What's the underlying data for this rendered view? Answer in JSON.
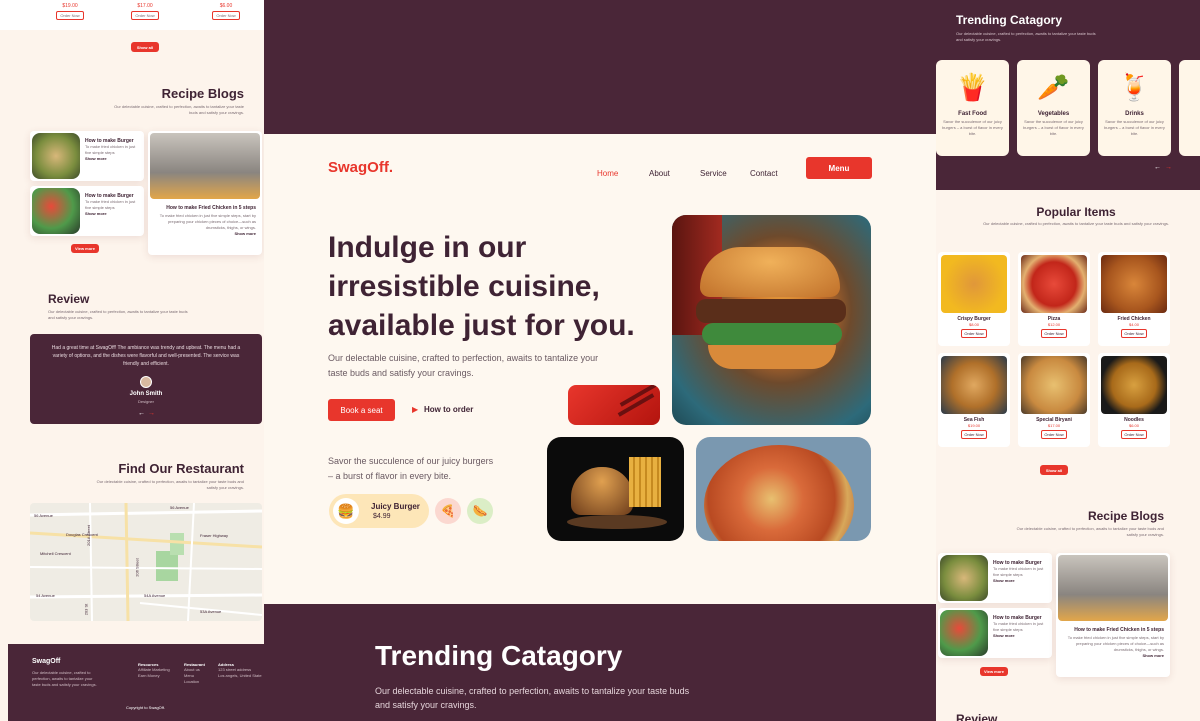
{
  "left": {
    "prices": [
      "$19.00",
      "$17.00",
      "$6.00"
    ],
    "order_now": "Order Now",
    "show_all": "Show all",
    "recipe": {
      "title": "Recipe Blogs",
      "subtitle": "Our delectable cuisine, crafted to perfection, awaits to tantalize your taste buds and satisfy your cravings.",
      "posts": [
        {
          "title": "How to make Burger",
          "text": "To make fried chicken in just five simple steps",
          "more": "Show more"
        },
        {
          "title": "How to make Burger",
          "text": "To make fried chicken in just five simple steps",
          "more": "Show more"
        }
      ],
      "feature": {
        "title": "How to make Fried Chicken in 5 steps",
        "text": "To make fried chicken in just five simple steps, start by preparing your chicken pieces of choice—such as drumsticks, thighs, or wings.",
        "more": "Show more"
      },
      "view_more": "View more"
    },
    "review": {
      "title": "Review",
      "subtitle": "Our delectable cuisine, crafted to perfection, awaits to tantalize your taste buds and satisfy your cravings.",
      "quote": "Had a great time at SwagOff! The ambiance was trendy and upbeat. The menu had a variety of options, and the dishes were flavorful and well-presented. The service was friendly and efficient.",
      "name": "John Smith",
      "role": "Designer"
    },
    "find": {
      "title": "Find Our Restaurant",
      "subtitle": "Our delectable cuisine, crafted to perfection, awaits to tantalize your taste buds and satisfy your cravings.",
      "streets": [
        "56 Avenue",
        "56 Avenue",
        "Douglas Crescent",
        "Fraser Highway",
        "Mitchell Crescent",
        "54 Avenue",
        "54A Avenue",
        "53A Avenue",
        "206 Street",
        "201A Street",
        "203 St"
      ]
    },
    "footer": {
      "brand": "SwagOff",
      "desc": "Our delectable cuisine, crafted to perfection, awaits to tantalize your taste buds and satisfy your cravings.",
      "cols": [
        {
          "title": "Resources",
          "items": [
            "Affiliate Marketing",
            "Earn Money"
          ]
        },
        {
          "title": "Restaurant",
          "items": [
            "About us",
            "Menu",
            "Location"
          ]
        },
        {
          "title": "Address",
          "items": [
            "123 street address",
            "Los angels, United State"
          ]
        }
      ],
      "copyright": "Copyright to SwagOff."
    }
  },
  "center": {
    "brand": "SwagOff.",
    "nav": [
      "Home",
      "About",
      "Service",
      "Contact"
    ],
    "menu_button": "Menu",
    "headline": [
      "Indulge in our",
      "irresistible cuisine,",
      "available just for you."
    ],
    "subtext": "Our delectable cuisine, crafted to perfection, awaits to tantalize your taste buds and satisfy your cravings.",
    "book": "Book a seat",
    "how_to_order": "How to order",
    "savor": "Savor the succulence of our juicy burgers – a burst of flavor in every bite.",
    "product": {
      "name": "Juicy Burger",
      "price": "$4.99"
    },
    "trending": {
      "title": "Trending Catagory",
      "subtitle": "Our delectable cuisine, crafted to perfection, awaits to tantalize your taste buds and satisfy your cravings."
    }
  },
  "right": {
    "trending": {
      "title": "Trending Catagory",
      "subtitle": "Our delectable cuisine, crafted to perfection, awaits to tantalize your taste buds and satisfy your cravings.",
      "cards": [
        {
          "name": "Fast Food",
          "text": "Savor the succulence of our juicy burgers – a burst of flavor in every bite."
        },
        {
          "name": "Vegetables",
          "text": "Savor the succulence of our juicy burgers – a burst of flavor in every bite."
        },
        {
          "name": "Drinks",
          "text": "Savor the succulence of our juicy burgers – a burst of flavor in every bite."
        }
      ]
    },
    "popular": {
      "title": "Popular Items",
      "subtitle": "Our delectable cuisine, crafted to perfection, awaits to tantalize your taste buds and satisfy your cravings.",
      "items": [
        {
          "name": "Crispy Burger",
          "price": "$8.00"
        },
        {
          "name": "Pizza",
          "price": "$12.00"
        },
        {
          "name": "Fried Chicken",
          "price": "$4.00"
        },
        {
          "name": "Sea Fish",
          "price": "$19.00"
        },
        {
          "name": "Special Biryani",
          "price": "$17.00"
        },
        {
          "name": "Noodles",
          "price": "$6.00"
        }
      ],
      "order_now": "Order Now",
      "show_all": "Show all"
    },
    "recipe": {
      "title": "Recipe Blogs",
      "subtitle": "Our delectable cuisine, crafted to perfection, awaits to tantalize your taste buds and satisfy your cravings.",
      "posts": [
        {
          "title": "How to make Burger",
          "text": "To make fried chicken in just five simple steps",
          "more": "Show more"
        },
        {
          "title": "How to make Burger",
          "text": "To make fried chicken in just five simple steps",
          "more": "Show more"
        }
      ],
      "feature": {
        "title": "How to make Fried Chicken in 5 steps",
        "text": "To make fried chicken in just five simple steps, start by preparing your chicken pieces of choice—such as drumsticks, thighs, or wings.",
        "more": "Show more"
      },
      "view_more": "View more"
    },
    "review_title": "Review"
  },
  "colors": {
    "accent": "#e8362c",
    "maroon": "#4a2638",
    "cream": "#fdf6ee"
  }
}
